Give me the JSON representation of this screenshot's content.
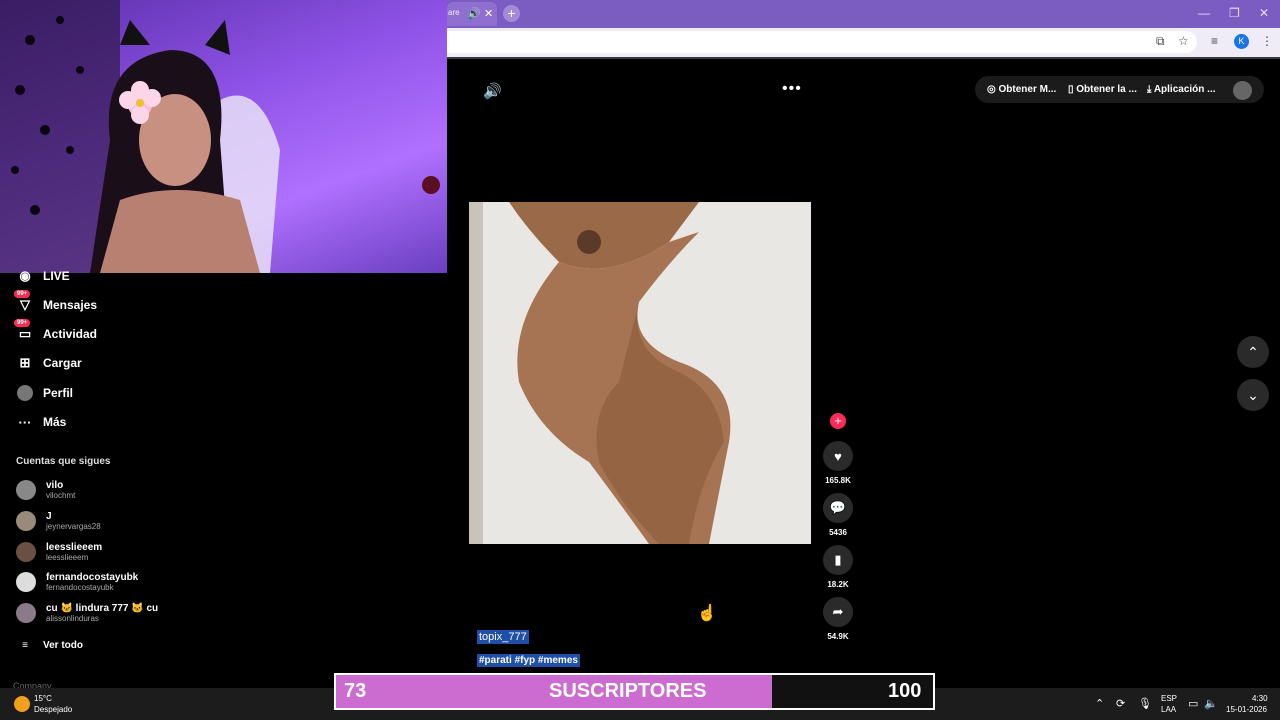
{
  "browser": {
    "tab_title": "are",
    "new_tab_label": "+",
    "minimize": "—",
    "restore": "❐",
    "close": "✕",
    "profile_initial": "K"
  },
  "sidebar": {
    "items": [
      {
        "label": "LIVE",
        "icon": "live-icon"
      },
      {
        "label": "Mensajes",
        "icon": "messages-icon",
        "badge": "99+"
      },
      {
        "label": "Actividad",
        "icon": "activity-icon",
        "badge": "99+"
      },
      {
        "label": "Cargar",
        "icon": "upload-icon"
      },
      {
        "label": "Perfil",
        "icon": "profile-icon"
      },
      {
        "label": "Más",
        "icon": "more-icon"
      }
    ],
    "following_title": "Cuentas que sigues",
    "following": [
      {
        "name": "vilo",
        "user": "vilochmt"
      },
      {
        "name": "J",
        "user": "jeynervargas28"
      },
      {
        "name": "leesslieeem",
        "user": "leesslieeem"
      },
      {
        "name": "fernandocostayubk",
        "user": "fernandocostayubk"
      },
      {
        "name": "cu 🐱 lindura 777 🐱 cu",
        "user": "alissonlinduras"
      }
    ],
    "see_all": "Ver todo",
    "company": "Company"
  },
  "topbar": {
    "get_coins": "Obtener M...",
    "get_app": "Obtener la ...",
    "app": "Aplicación ..."
  },
  "video": {
    "author": "topix_777",
    "hashtags": "#parati #fyp #memes",
    "likes": "165.8K",
    "comments": "5436",
    "saves": "18.2K",
    "shares": "54.9K"
  },
  "subgoal": {
    "current": "73",
    "label": "SUSCRIPTORES",
    "goal": "100",
    "progress": 0.73
  },
  "taskbar": {
    "temp": "15°C",
    "weather": "Despejado",
    "lang1": "ESP",
    "lang2": "LAA",
    "time": "4:30",
    "date": "15-01-2026"
  },
  "colors": {
    "accent_pink": "#fe2c55",
    "tab_bar": "#7b5cc0",
    "subbar_fill": "#cc6bd0"
  }
}
